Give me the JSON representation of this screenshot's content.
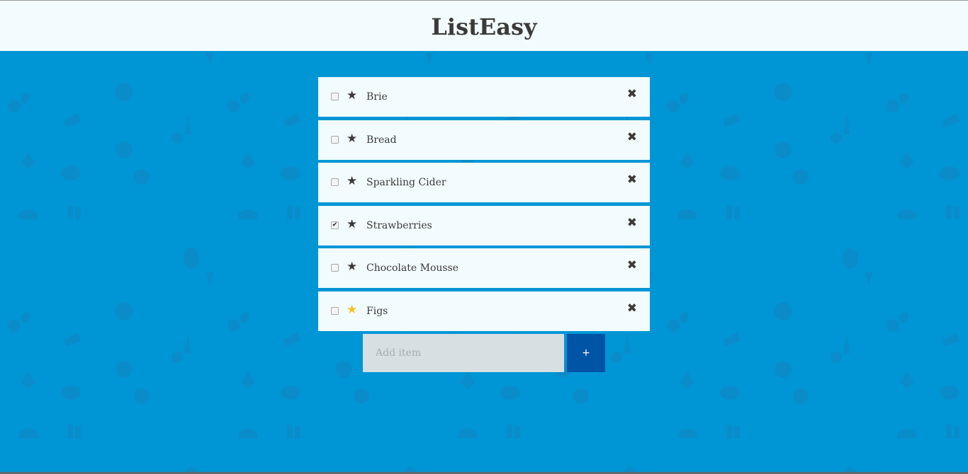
{
  "header": {
    "title": "ListEasy"
  },
  "items": [
    {
      "label": "Brie",
      "checked": false,
      "starred": false,
      "star_glyph": "★",
      "remove_glyph": "✖",
      "check_glyph": ""
    },
    {
      "label": "Bread",
      "checked": false,
      "starred": false,
      "star_glyph": "★",
      "remove_glyph": "✖",
      "check_glyph": ""
    },
    {
      "label": "Sparkling Cider",
      "checked": false,
      "starred": false,
      "star_glyph": "★",
      "remove_glyph": "✖",
      "check_glyph": ""
    },
    {
      "label": "Strawberries",
      "checked": true,
      "starred": false,
      "star_glyph": "★",
      "remove_glyph": "✖",
      "check_glyph": "✔"
    },
    {
      "label": "Chocolate Mousse",
      "checked": false,
      "starred": false,
      "star_glyph": "★",
      "remove_glyph": "✖",
      "check_glyph": ""
    },
    {
      "label": "Figs",
      "checked": false,
      "starred": true,
      "star_glyph": "★",
      "remove_glyph": "✖",
      "check_glyph": ""
    }
  ],
  "add": {
    "placeholder": "Add item",
    "value": "",
    "button_label": "+"
  },
  "colors": {
    "background": "#0096d6",
    "header_bg": "#f2fbfe",
    "item_bg": "#f2fbfe",
    "text": "#3c3a38",
    "star_active": "#f6c21a",
    "input_bg": "#d7dfe2",
    "button_bg": "#0054a6"
  },
  "icons": {
    "star": "star-icon",
    "remove": "close-icon",
    "checkbox": "checkbox"
  }
}
